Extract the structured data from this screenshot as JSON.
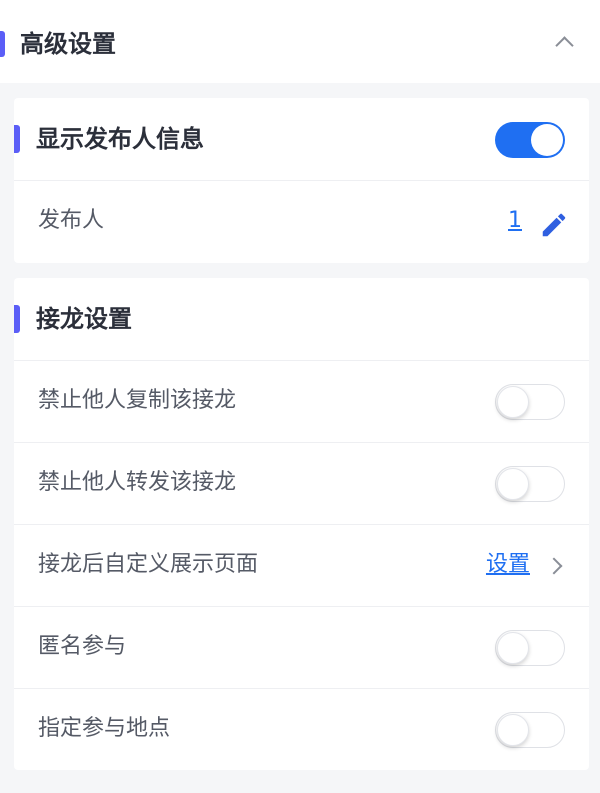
{
  "header": {
    "title": "高级设置",
    "collapse_icon": "chevron-up-icon"
  },
  "publisher_section": {
    "title": "显示发布人信息",
    "toggle_on": true,
    "publisher_row": {
      "label": "发布人",
      "value": "1",
      "edit_icon": "pencil-icon"
    }
  },
  "relay_section": {
    "title": "接龙设置",
    "rows": [
      {
        "label": "禁止他人复制该接龙",
        "type": "toggle",
        "on": false
      },
      {
        "label": "禁止他人转发该接龙",
        "type": "toggle",
        "on": false
      },
      {
        "label": "接龙后自定义展示页面",
        "type": "link",
        "link_text": "设置",
        "icon": "chevron-right-icon"
      },
      {
        "label": "匿名参与",
        "type": "toggle",
        "on": false
      },
      {
        "label": "指定参与地点",
        "type": "toggle",
        "on": false
      }
    ]
  },
  "colors": {
    "accent": "#5b5ef7",
    "primary": "#1f6ff2",
    "background": "#f5f6f8"
  }
}
